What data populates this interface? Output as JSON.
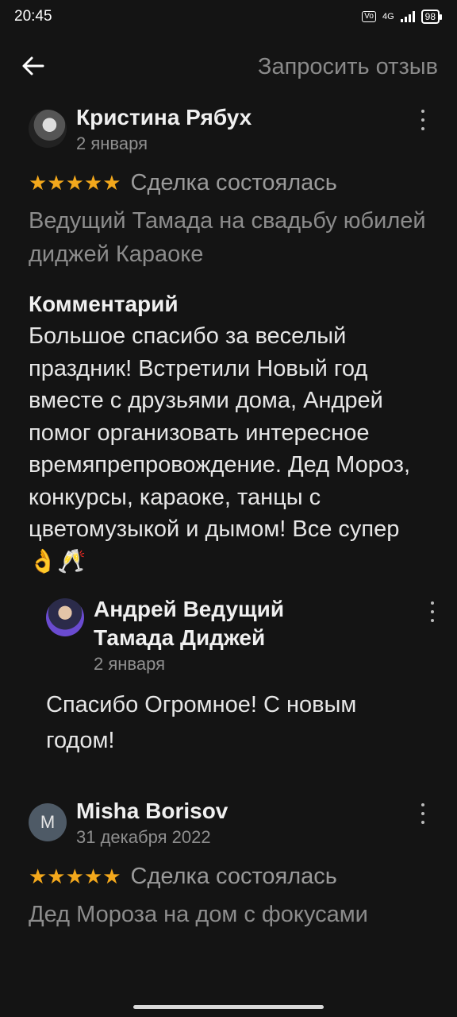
{
  "status_bar": {
    "time": "20:45",
    "network": "4G",
    "volte": "Vo LTE",
    "battery": "98"
  },
  "app_bar": {
    "back_icon": "arrow-left-icon",
    "request_review_label": "Запросить отзыв"
  },
  "reviews": [
    {
      "author": "Кристина Рябух",
      "date": "2 января",
      "rating": 5,
      "stars": "★★★★★",
      "deal_status": "Сделка состоялась",
      "service": "Ведущий Тамада на свадьбу юбилей диджей Караоке",
      "comment_title": "Комментарий",
      "comment": "Большое спасибо за веселый праздник! Встретили Новый год вместе с друзьями дома, Андрей помог организовать интересное времяпрепровождение. Дед Мороз, конкурсы, караоке, танцы с цветомузыкой и дымом! Все супер 👌🥂",
      "reply": {
        "author": "Андрей Ведущий Тамада Диджей",
        "date": "2 января",
        "text": "Спасибо Огромное! С новым годом!"
      }
    },
    {
      "author": "Misha Borisov",
      "avatar_letter": "M",
      "date": "31 декабря 2022",
      "rating": 5,
      "stars": "★★★★★",
      "deal_status": "Сделка состоялась",
      "service": "Дед Мороза на дом с фокусами"
    }
  ],
  "colors": {
    "background": "#141414",
    "star": "#f3a81c",
    "muted_text": "#8c8c8c"
  }
}
